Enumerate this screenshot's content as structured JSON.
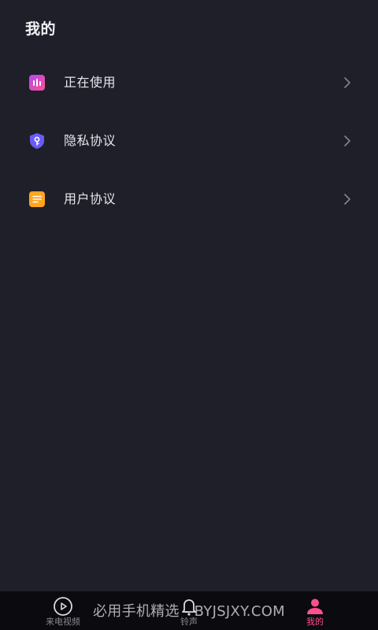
{
  "header": {
    "title": "我的"
  },
  "menu": {
    "items": [
      {
        "label": "正在使用",
        "icon": "sound-bars-icon",
        "color": "#ff4f8e"
      },
      {
        "label": "隐私协议",
        "icon": "shield-key-icon",
        "color": "#6a5cf6"
      },
      {
        "label": "用户协议",
        "icon": "document-list-icon",
        "color": "#ffa51f"
      }
    ]
  },
  "tabbar": {
    "tabs": [
      {
        "label": "来电视频",
        "icon": "play-circle-icon",
        "active": false
      },
      {
        "label": "铃声",
        "icon": "bell-icon",
        "active": false
      },
      {
        "label": "我的",
        "icon": "person-icon",
        "active": true
      }
    ]
  },
  "watermark": {
    "text": "必用手机精选 - BYJSJXY.COM"
  },
  "colors": {
    "background": "#1f1f29",
    "tabbar_background": "#0a0a0f",
    "accent": "#ff4f8e"
  }
}
